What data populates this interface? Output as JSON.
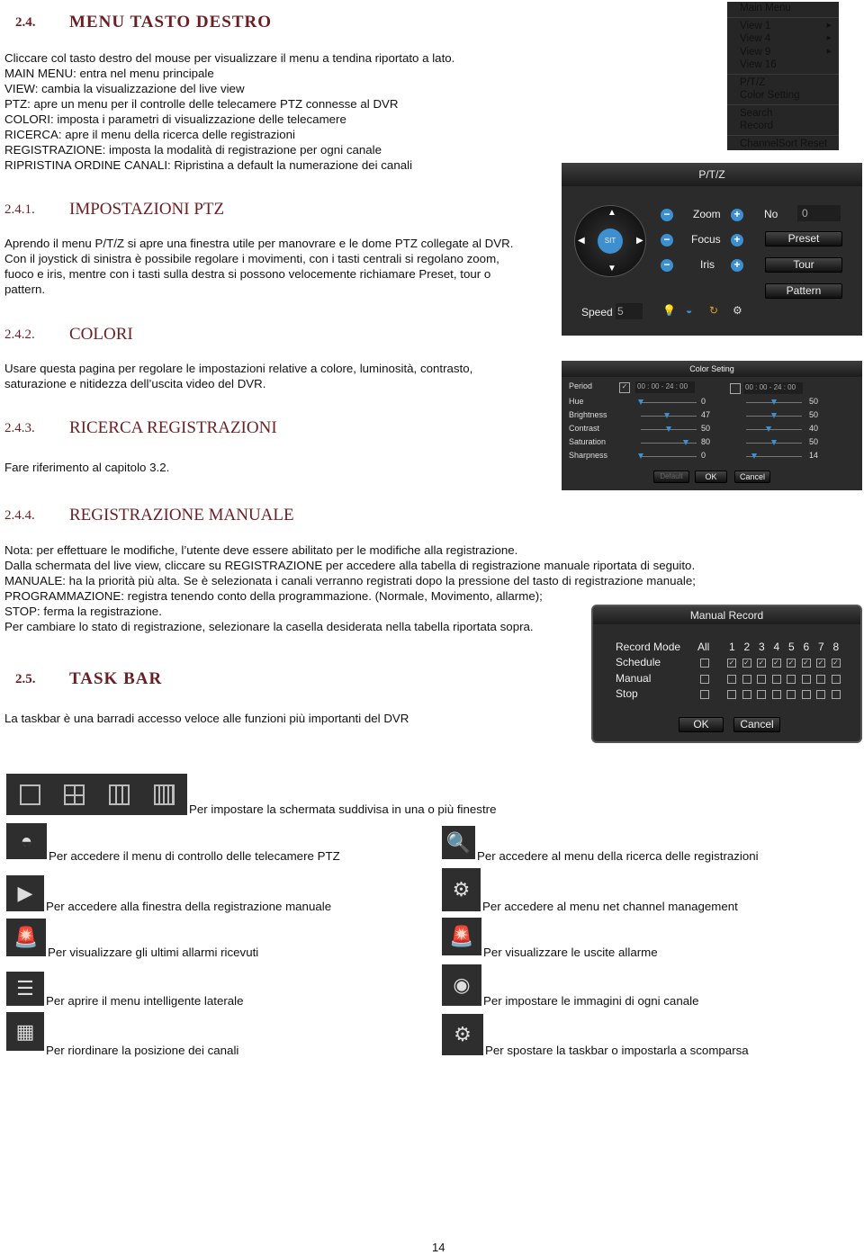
{
  "sections": {
    "s24": {
      "num": "2.4.",
      "title": "MENU TASTO DESTRO",
      "lines": [
        "Cliccare col tasto destro del mouse per visualizzare il menu a tendina riportato a lato.",
        "MAIN MENU: entra nel menu principale",
        "VIEW: cambia la visualizzazione del live view",
        "PTZ: apre un menu per il controlle delle telecamere PTZ connesse al DVR",
        "COLORI: imposta i parametri di visualizzazione delle telecamere",
        "RICERCA: apre il menu della ricerca delle registrazioni",
        "REGISTRAZIONE: imposta la modalità di registrazione per ogni canale",
        "RIPRISTINA ORDINE CANALI: Ripristina a default la numerazione dei canali"
      ]
    },
    "s241": {
      "num": "2.4.1.",
      "title": "IMPOSTAZIONI PTZ",
      "lines": [
        "Aprendo il menu P/T/Z si apre una finestra utile per manovrare e le dome PTZ collegate al DVR.",
        "Con il joystick di sinistra è possibile regolare i movimenti, con i tasti centrali si regolano zoom,",
        "fuoco e iris, mentre con i tasti sulla destra si possono velocemente richiamare Preset, tour o",
        "pattern."
      ]
    },
    "s242": {
      "num": "2.4.2.",
      "title": "COLORI",
      "lines": [
        "Usare questa pagina per regolare le impostazioni relative a colore, luminosità, contrasto,",
        "saturazione e nitidezza dell’uscita video del DVR."
      ]
    },
    "s243": {
      "num": "2.4.3.",
      "title": "RICERCA REGISTRAZIONI",
      "lines": [
        "Fare riferimento al capitolo 3.2."
      ]
    },
    "s244": {
      "num": "2.4.4.",
      "title": "REGISTRAZIONE MANUALE",
      "lines": [
        "Nota: per effettuare le modifiche, l’utente deve essere abilitato per le modifiche alla registrazione.",
        "Dalla schermata del live view, cliccare su REGISTRAZIONE per accedere alla tabella di registrazione manuale riportata di seguito.",
        "MANUALE: ha la priorità più alta. Se è selezionata i canali verranno registrati dopo la pressione del tasto di registrazione manuale;",
        "PROGRAMMAZIONE: registra tenendo conto della programmazione. (Normale, Movimento, allarme);",
        "STOP: ferma la registrazione.",
        "Per cambiare lo stato di registrazione, selezionare la casella desiderata nella tabella riportata sopra."
      ]
    },
    "s25": {
      "num": "2.5.",
      "title": "TASK BAR",
      "lines": [
        "La taskbar è una barradi accesso veloce alle funzioni più importanti del DVR"
      ]
    }
  },
  "main_menu": {
    "title": "Main Menu",
    "items": [
      "View 1",
      "View 4",
      "View 9",
      "View 16",
      "P/T/Z",
      "Color Setting",
      "Search",
      "Record",
      "ChannelSort Reset"
    ]
  },
  "ptz": {
    "title": "P/T/Z",
    "center": "SIT",
    "zoom": "Zoom",
    "focus": "Focus",
    "iris": "Iris",
    "no_label": "No",
    "no_value": "0",
    "preset": "Preset",
    "tour": "Tour",
    "pattern": "Pattern",
    "speed_label": "Speed",
    "speed_value": "5"
  },
  "color": {
    "title": "Color Seting",
    "period": "Period",
    "period1": "00 : 00 - 24 : 00",
    "period2": "00 : 00 - 24 : 00",
    "period1_checked": true,
    "period2_checked": false,
    "rows": [
      {
        "label": "Hue",
        "v1": 0,
        "v2": 50
      },
      {
        "label": "Brightness",
        "v1": 47,
        "v2": 50
      },
      {
        "label": "Contrast",
        "v1": 50,
        "v2": 40
      },
      {
        "label": "Saturation",
        "v1": 80,
        "v2": 50
      },
      {
        "label": "Sharpness",
        "v1": 0,
        "v2": 14
      }
    ],
    "default": "Default",
    "ok": "OK",
    "cancel": "Cancel"
  },
  "manual": {
    "title": "Manual Record",
    "mode": "Record Mode",
    "all": "All",
    "channels": [
      "1",
      "2",
      "3",
      "4",
      "5",
      "6",
      "7",
      "8"
    ],
    "rows": [
      {
        "label": "Schedule",
        "all": false,
        "ch": [
          true,
          true,
          true,
          true,
          true,
          true,
          true,
          true
        ]
      },
      {
        "label": "Manual",
        "all": false,
        "ch": [
          false,
          false,
          false,
          false,
          false,
          false,
          false,
          false
        ]
      },
      {
        "label": "Stop",
        "all": false,
        "ch": [
          false,
          false,
          false,
          false,
          false,
          false,
          false,
          false
        ]
      }
    ],
    "ok": "OK",
    "cancel": "Cancel"
  },
  "taskbar": {
    "views": "Per impostare la schermata suddivisa in una o più finestre",
    "left": [
      {
        "icon": "ptz-camera-icon",
        "text": "Per accedere il menu di controllo delle telecamere PTZ"
      },
      {
        "icon": "record-clapper-icon",
        "text": "Per accedere alla finestra della registrazione manuale"
      },
      {
        "icon": "alarm-siren-icon",
        "text": "Per visualizzare gli ultimi allarmi ricevuti"
      },
      {
        "icon": "smart-menu-icon",
        "text": "Per aprire il menu intelligente laterale"
      },
      {
        "icon": "channel-reorder-icon",
        "text": "Per riordinare la posizione dei canali"
      }
    ],
    "right": [
      {
        "icon": "search-playback-icon",
        "text": "Per accedere al menu della ricerca delle registrazioni"
      },
      {
        "icon": "net-channel-gear-icon",
        "text": "Per accedere al menu net channel management"
      },
      {
        "icon": "alarm-output-icon",
        "text": "Per visualizzare le uscite allarme"
      },
      {
        "icon": "color-lens-icon",
        "text": "Per impostare le immagini di ogni canale"
      },
      {
        "icon": "taskbar-settings-icon",
        "text": "Per spostare la taskbar o impostarla a scomparsa"
      }
    ]
  },
  "page_number": "14"
}
